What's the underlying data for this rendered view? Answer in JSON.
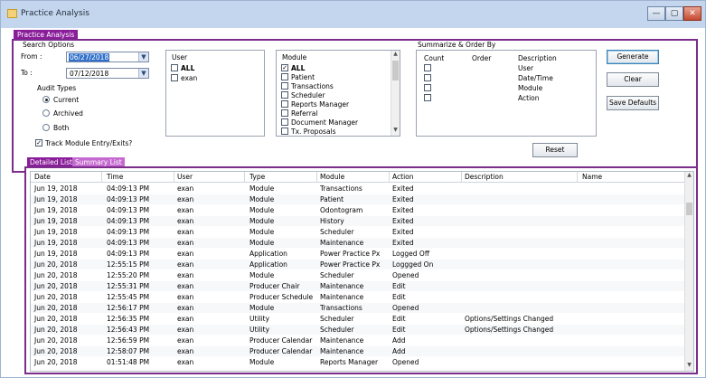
{
  "window": {
    "title": "Practice Analysis",
    "controls": {
      "minimize": "—",
      "maximize": "▢",
      "close": "✕"
    }
  },
  "top_tab": "Practice Analysis",
  "search_options": {
    "label": "Search Options",
    "from_label": "From :",
    "from_value": "06/27/2018",
    "to_label": "To :",
    "to_value": "07/12/2018",
    "audit_types_label": "Audit Types",
    "audit_types": [
      {
        "label": "Current",
        "selected": true
      },
      {
        "label": "Archived",
        "selected": false
      },
      {
        "label": "Both",
        "selected": false
      }
    ],
    "track_label": "Track Module Entry/Exits?",
    "track_checked": true
  },
  "user_list": {
    "header": "User",
    "items": [
      {
        "label": "ALL",
        "checked": false
      },
      {
        "label": "exan",
        "checked": false
      }
    ]
  },
  "module_list": {
    "header": "Module",
    "items": [
      {
        "label": "ALL",
        "checked": true
      },
      {
        "label": "Patient",
        "checked": false
      },
      {
        "label": "Transactions",
        "checked": false
      },
      {
        "label": "Scheduler",
        "checked": false
      },
      {
        "label": "Reports Manager",
        "checked": false
      },
      {
        "label": "Referral",
        "checked": false
      },
      {
        "label": "Document Manager",
        "checked": false
      },
      {
        "label": "Tx. Proposals",
        "checked": false
      }
    ]
  },
  "summarize": {
    "label": "Summarize & Order By",
    "headers": {
      "count": "Count",
      "order": "Order",
      "description": "Description"
    },
    "rows": [
      {
        "description": "User"
      },
      {
        "description": "Date/Time"
      },
      {
        "description": "Module"
      },
      {
        "description": "Action"
      }
    ],
    "reset_label": "Reset"
  },
  "buttons": {
    "generate": "Generate",
    "clear": "Clear",
    "save_defaults": "Save Defaults"
  },
  "list_tabs": [
    {
      "label": "Detailed List",
      "active": true
    },
    {
      "label": "Summary List",
      "active": false
    }
  ],
  "grid": {
    "columns": [
      "Date",
      "Time",
      "User",
      "Type",
      "Module",
      "Action",
      "Description",
      "Name"
    ],
    "rows": [
      [
        "Jun 19, 2018",
        "04:09:13 PM",
        "exan",
        "Module",
        "Transactions",
        "Exited",
        "",
        ""
      ],
      [
        "Jun 19, 2018",
        "04:09:13 PM",
        "exan",
        "Module",
        "Patient",
        "Exited",
        "",
        ""
      ],
      [
        "Jun 19, 2018",
        "04:09:13 PM",
        "exan",
        "Module",
        "Odontogram",
        "Exited",
        "",
        ""
      ],
      [
        "Jun 19, 2018",
        "04:09:13 PM",
        "exan",
        "Module",
        "History",
        "Exited",
        "",
        ""
      ],
      [
        "Jun 19, 2018",
        "04:09:13 PM",
        "exan",
        "Module",
        "Scheduler",
        "Exited",
        "",
        ""
      ],
      [
        "Jun 19, 2018",
        "04:09:13 PM",
        "exan",
        "Module",
        "Maintenance",
        "Exited",
        "",
        ""
      ],
      [
        "Jun 19, 2018",
        "04:09:13 PM",
        "exan",
        "Application",
        "Power Practice Px",
        "Logged Off",
        "",
        ""
      ],
      [
        "Jun 20, 2018",
        "12:55:15 PM",
        "exan",
        "Application",
        "Power Practice Px",
        "Loggged On",
        "",
        ""
      ],
      [
        "Jun 20, 2018",
        "12:55:20 PM",
        "exan",
        "Module",
        "Scheduler",
        "Opened",
        "",
        ""
      ],
      [
        "Jun 20, 2018",
        "12:55:31 PM",
        "exan",
        "Producer Chair",
        "Maintenance",
        "Edit",
        "",
        ""
      ],
      [
        "Jun 20, 2018",
        "12:55:45 PM",
        "exan",
        "Producer Schedule",
        "Maintenance",
        "Edit",
        "",
        ""
      ],
      [
        "Jun 20, 2018",
        "12:56:17 PM",
        "exan",
        "Module",
        "Transactions",
        "Opened",
        "",
        ""
      ],
      [
        "Jun 20, 2018",
        "12:56:35 PM",
        "exan",
        "Utility",
        "Scheduler",
        "Edit",
        "Options/Settings Changed",
        ""
      ],
      [
        "Jun 20, 2018",
        "12:56:43 PM",
        "exan",
        "Utility",
        "Scheduler",
        "Edit",
        "Options/Settings Changed",
        ""
      ],
      [
        "Jun 20, 2018",
        "12:56:59 PM",
        "exan",
        "Producer Calendar",
        "Maintenance",
        "Add",
        "",
        ""
      ],
      [
        "Jun 20, 2018",
        "12:58:07 PM",
        "exan",
        "Producer Calendar",
        "Maintenance",
        "Add",
        "",
        ""
      ],
      [
        "Jun 20, 2018",
        "01:51:48 PM",
        "exan",
        "Module",
        "Reports Manager",
        "Opened",
        "",
        ""
      ]
    ]
  }
}
